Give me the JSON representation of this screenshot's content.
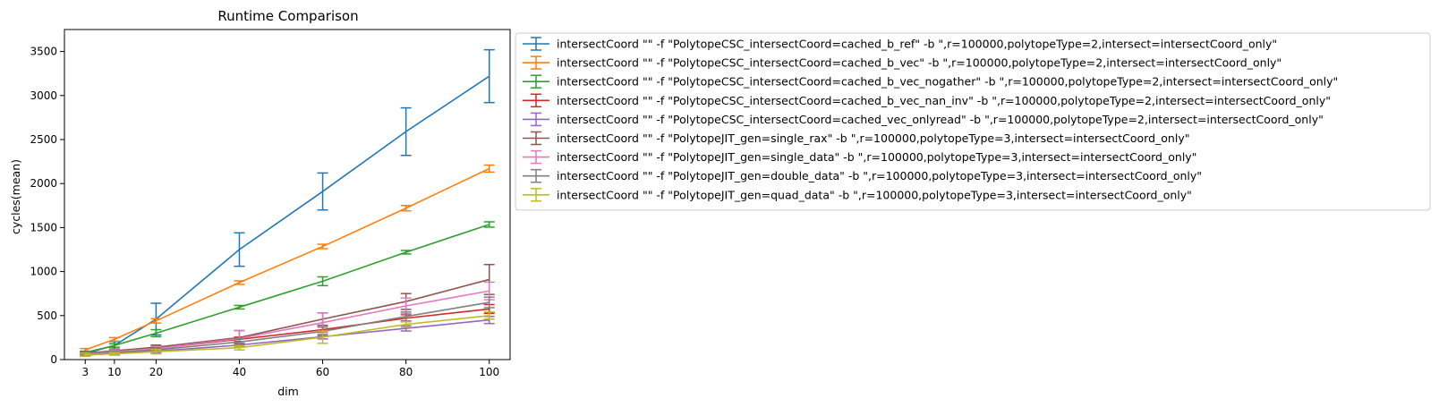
{
  "chart_data": {
    "type": "line",
    "title": "Runtime Comparison",
    "xlabel": "dim",
    "ylabel": "cycles(mean)",
    "x": [
      3,
      10,
      20,
      40,
      60,
      80,
      100
    ],
    "xticks": [
      3,
      10,
      20,
      40,
      60,
      80,
      100
    ],
    "xlim": [
      -2,
      105
    ],
    "ylim": [
      0,
      3750
    ],
    "yticks": [
      0,
      500,
      1000,
      1500,
      2000,
      2500,
      3000,
      3500
    ],
    "grid": false,
    "legend_position": "outside-right-top",
    "series": [
      {
        "name": "intersectCoord \"\" -f \"PolytopeCSC_intersectCoord=cached_b_ref\" -b \",r=100000,polytopeType=2,intersect=intersectCoord_only\"",
        "color": "#1f77b4",
        "values": [
          70,
          160,
          460,
          1250,
          1910,
          2590,
          3220
        ],
        "errors": [
          20,
          45,
          180,
          190,
          210,
          270,
          300
        ]
      },
      {
        "name": "intersectCoord \"\" -f \"PolytopeCSC_intersectCoord=cached_b_vec\" -b \",r=100000,polytopeType=2,intersect=intersectCoord_only\"",
        "color": "#ff7f0e",
        "values": [
          110,
          230,
          440,
          875,
          1285,
          1720,
          2170
        ],
        "errors": [
          15,
          20,
          25,
          20,
          25,
          30,
          40
        ]
      },
      {
        "name": "intersectCoord \"\" -f \"PolytopeCSC_intersectCoord=cached_b_vec_nogather\" -b \",r=100000,polytopeType=2,intersect=intersectCoord_only\"",
        "color": "#2ca02c",
        "values": [
          80,
          160,
          300,
          595,
          890,
          1220,
          1535
        ],
        "errors": [
          15,
          20,
          40,
          20,
          50,
          20,
          30
        ]
      },
      {
        "name": "intersectCoord \"\" -f \"PolytopeCSC_intersectCoord=cached_b_vec_nan_inv\" -b \",r=100000,polytopeType=2,intersect=intersectCoord_only\"",
        "color": "#d62728",
        "values": [
          70,
          90,
          125,
          230,
          340,
          470,
          575
        ],
        "errors": [
          10,
          15,
          20,
          25,
          30,
          40,
          50
        ]
      },
      {
        "name": "intersectCoord \"\" -f \"PolytopeCSC_intersectCoord=cached_vec_onlyread\" -b \",r=100000,polytopeType=2,intersect=intersectCoord_only\"",
        "color": "#9467bd",
        "values": [
          50,
          70,
          95,
          165,
          260,
          355,
          450
        ],
        "errors": [
          10,
          10,
          15,
          20,
          25,
          30,
          40
        ]
      },
      {
        "name": "intersectCoord \"\" -f \"PolytopeJIT_gen=single_rax\" -b \",r=100000,polytopeType=3,intersect=intersectCoord_only\"",
        "color": "#8c564b",
        "values": [
          75,
          100,
          140,
          250,
          460,
          660,
          910
        ],
        "errors": [
          15,
          20,
          25,
          80,
          70,
          90,
          170
        ]
      },
      {
        "name": "intersectCoord \"\" -f \"PolytopeJIT_gen=single_data\" -b \",r=100000,polytopeType=3,intersect=intersectCoord_only\"",
        "color": "#e377c2",
        "values": [
          65,
          90,
          125,
          240,
          420,
          610,
          780
        ],
        "errors": [
          15,
          20,
          25,
          90,
          110,
          90,
          100
        ]
      },
      {
        "name": "intersectCoord \"\" -f \"PolytopeJIT_gen=double_data\" -b \",r=100000,polytopeType=3,intersect=intersectCoord_only\"",
        "color": "#7f7f7f",
        "values": [
          60,
          80,
          110,
          200,
          320,
          490,
          650
        ],
        "errors": [
          15,
          15,
          20,
          40,
          50,
          50,
          60
        ]
      },
      {
        "name": "intersectCoord \"\" -f \"PolytopeJIT_gen=quad_data\" -b \",r=100000,polytopeType=3,intersect=intersectCoord_only\"",
        "color": "#bcbd22",
        "values": [
          55,
          65,
          90,
          135,
          255,
          400,
          500
        ],
        "errors": [
          15,
          15,
          25,
          25,
          70,
          30,
          40
        ]
      }
    ]
  }
}
